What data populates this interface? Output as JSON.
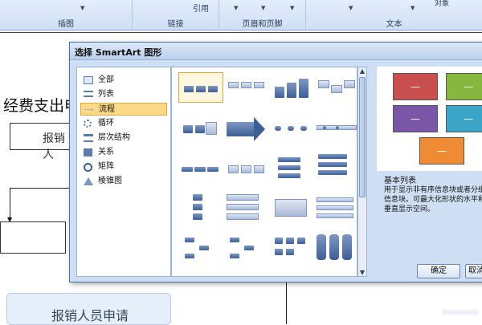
{
  "ribbon": {
    "groups": [
      "插图",
      "链接",
      "页眉和页脚",
      "文本"
    ],
    "ref_label": "引用",
    "object_label": "对象"
  },
  "document": {
    "heading": "经费支出申",
    "box_text": "报销人",
    "bottom_text": "报销人员申请"
  },
  "dialog": {
    "title": "选择 SmartArt 图形",
    "categories": [
      {
        "label": "全部",
        "icon": "all-icon"
      },
      {
        "label": "列表",
        "icon": "list-icon"
      },
      {
        "label": "流程",
        "icon": "process-icon",
        "selected": true
      },
      {
        "label": "循环",
        "icon": "cycle-icon"
      },
      {
        "label": "层次结构",
        "icon": "hierarchy-icon"
      },
      {
        "label": "关系",
        "icon": "relationship-icon"
      },
      {
        "label": "矩阵",
        "icon": "matrix-icon"
      },
      {
        "label": "棱锥图",
        "icon": "pyramid-icon"
      }
    ],
    "preview": {
      "tile_label": "—",
      "colors": [
        "#c94f4f",
        "#86b83f",
        "#7a56a6",
        "#3ba4c7",
        "#ef8b34"
      ],
      "name": "基本列表",
      "description": "用于显示非有序信息块或者分组信息块。可最大化形状的水平和垂直显示空间。"
    },
    "ok_label": "确定",
    "cancel_label": "取消"
  }
}
